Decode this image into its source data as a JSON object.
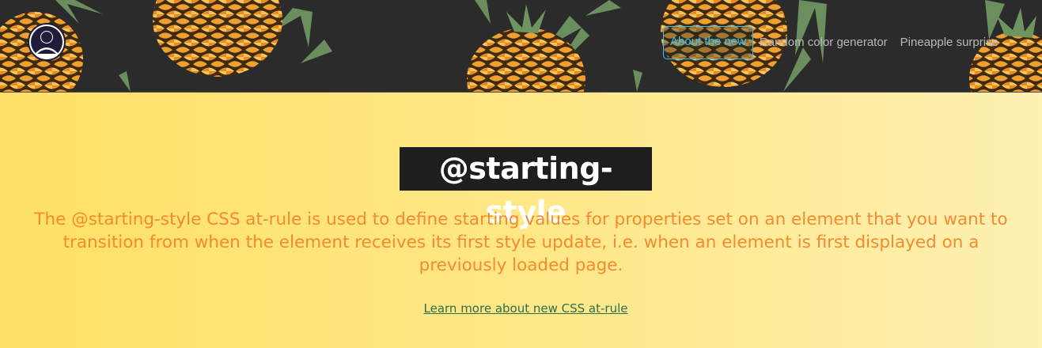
{
  "header": {
    "nav": [
      {
        "label": "About the new",
        "active": true
      },
      {
        "label": "Random color generator",
        "active": false
      },
      {
        "label": "Pineapple surprise",
        "active": false
      }
    ]
  },
  "main": {
    "title": "@starting-style",
    "description": "The @starting-style CSS at-rule is used to define starting values for properties set on an element that you want to transition from when the element receives its first style update, i.e. when an element is first displayed on a previously loaded page.",
    "link": "Learn more about new CSS at-rule"
  },
  "colors": {
    "header_bg": "#2b2b2b",
    "active_nav": "#33c6ff",
    "description": "#f58a2e",
    "link": "#2a6e4e"
  }
}
